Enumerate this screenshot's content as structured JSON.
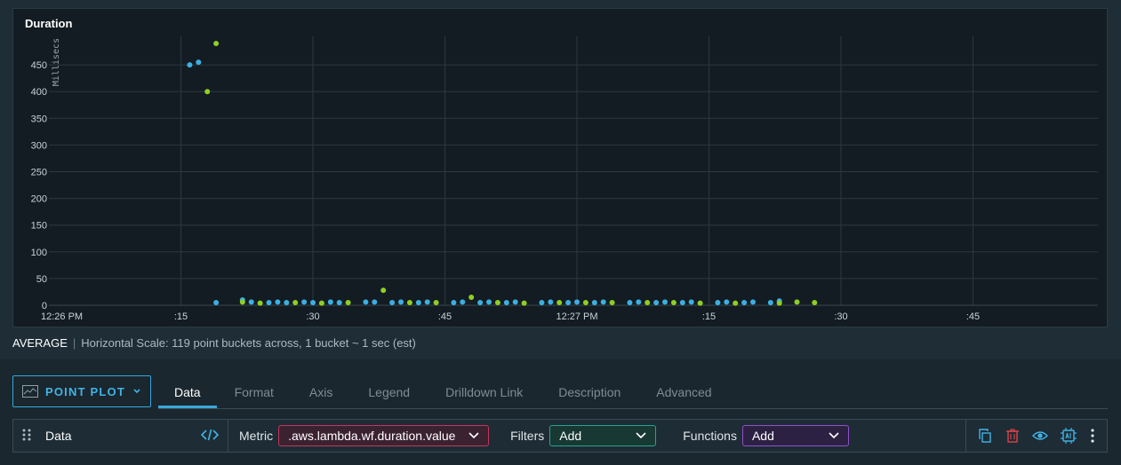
{
  "chart_data": {
    "type": "scatter",
    "title": "Duration",
    "ylabel": "Millisecs",
    "xlabel": "",
    "ylim": [
      0,
      500
    ],
    "y_ticks": [
      0,
      50,
      100,
      150,
      200,
      250,
      300,
      350,
      400,
      450
    ],
    "x_range": [
      "12:26 PM",
      "12:27:59 PM"
    ],
    "x_ticks": [
      {
        "t": 0,
        "label": "12:26 PM"
      },
      {
        "t": 15,
        "label": ":15"
      },
      {
        "t": 30,
        "label": ":30"
      },
      {
        "t": 45,
        "label": ":45"
      },
      {
        "t": 60,
        "label": "12:27 PM"
      },
      {
        "t": 75,
        "label": ":15"
      },
      {
        "t": 90,
        "label": ":30"
      },
      {
        "t": 105,
        "label": ":45"
      }
    ],
    "grid": true,
    "legend": "none",
    "series": [
      {
        "color": "#3ab0e2",
        "points": [
          [
            16,
            450
          ],
          [
            17,
            455
          ],
          [
            19,
            5
          ],
          [
            22,
            10
          ],
          [
            23,
            6
          ],
          [
            25,
            5
          ],
          [
            26,
            6
          ],
          [
            27,
            5
          ],
          [
            29,
            6
          ],
          [
            30,
            5
          ],
          [
            32,
            6
          ],
          [
            33,
            5
          ],
          [
            36,
            6
          ],
          [
            37,
            6
          ],
          [
            39,
            5
          ],
          [
            40,
            6
          ],
          [
            42,
            5
          ],
          [
            43,
            6
          ],
          [
            46,
            5
          ],
          [
            47,
            6
          ],
          [
            49,
            5
          ],
          [
            50,
            6
          ],
          [
            52,
            5
          ],
          [
            53,
            6
          ],
          [
            56,
            5
          ],
          [
            57,
            6
          ],
          [
            59,
            5
          ],
          [
            60,
            6
          ],
          [
            62,
            5
          ],
          [
            63,
            6
          ],
          [
            66,
            5
          ],
          [
            67,
            6
          ],
          [
            69,
            5
          ],
          [
            70,
            6
          ],
          [
            72,
            5
          ],
          [
            73,
            6
          ],
          [
            76,
            5
          ],
          [
            77,
            6
          ],
          [
            79,
            5
          ],
          [
            80,
            6
          ],
          [
            82,
            5
          ],
          [
            83,
            8
          ]
        ]
      },
      {
        "color": "#8fcf21",
        "points": [
          [
            18,
            400
          ],
          [
            19,
            490
          ],
          [
            22,
            6
          ],
          [
            24,
            4
          ],
          [
            28,
            5
          ],
          [
            31,
            4
          ],
          [
            34,
            5
          ],
          [
            38,
            28
          ],
          [
            41,
            5
          ],
          [
            44,
            5
          ],
          [
            48,
            15
          ],
          [
            51,
            5
          ],
          [
            54,
            4
          ],
          [
            58,
            5
          ],
          [
            61,
            5
          ],
          [
            64,
            5
          ],
          [
            68,
            5
          ],
          [
            71,
            5
          ],
          [
            74,
            4
          ],
          [
            78,
            4
          ],
          [
            83,
            4
          ],
          [
            85,
            6
          ],
          [
            87,
            5
          ]
        ]
      }
    ]
  },
  "summary": {
    "aggregation": "AVERAGE",
    "scale_text": "Horizontal Scale: 119 point buckets across, 1 bucket ~ 1 sec (est)"
  },
  "editor": {
    "chart_type_label": "POINT PLOT",
    "tabs": [
      {
        "label": "Data",
        "active": true
      },
      {
        "label": "Format"
      },
      {
        "label": "Axis"
      },
      {
        "label": "Legend"
      },
      {
        "label": "Drilldown Link"
      },
      {
        "label": "Description"
      },
      {
        "label": "Advanced"
      }
    ],
    "query": {
      "name": "Data",
      "metric_label": "Metric",
      "metric_value": ".aws.lambda.wf.duration.value",
      "filters_label": "Filters",
      "filters_value": "Add",
      "functions_label": "Functions",
      "functions_value": "Add"
    },
    "icons": [
      "copy-icon",
      "trash-icon",
      "eye-icon",
      "ai-chip-icon",
      "more-vertical-icon"
    ]
  }
}
